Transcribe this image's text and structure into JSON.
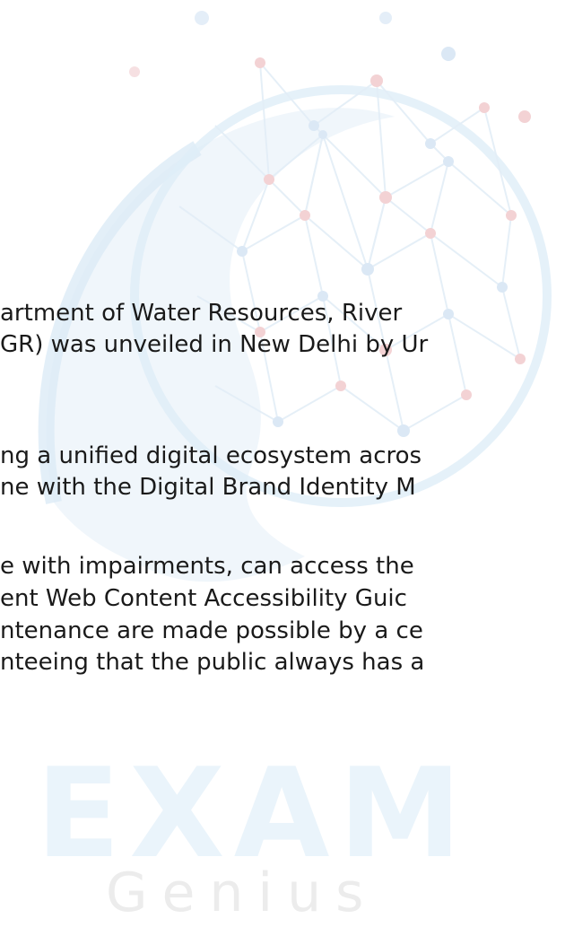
{
  "watermark": {
    "word": "EXAM",
    "subword": "Genius"
  },
  "paragraphs": [
    {
      "lines": [
        "artment of Water Resources, River",
        "GR) was unveiled in New Delhi by Ur"
      ]
    },
    {
      "lines": [
        "ng a unified digital ecosystem acros",
        "ne with the Digital Brand Identity M"
      ]
    },
    {
      "lines": [
        "e with impairments, can access the",
        "ent Web Content Accessibility Guic",
        "ntenance are made possible by a ce",
        "nteeing that the public always has a"
      ]
    }
  ],
  "colors": {
    "text": "#1a1a1a",
    "watermark_blue": "#dbeaf6",
    "watermark_red": "#f3c9cc",
    "watermark_grey": "#ececec"
  }
}
